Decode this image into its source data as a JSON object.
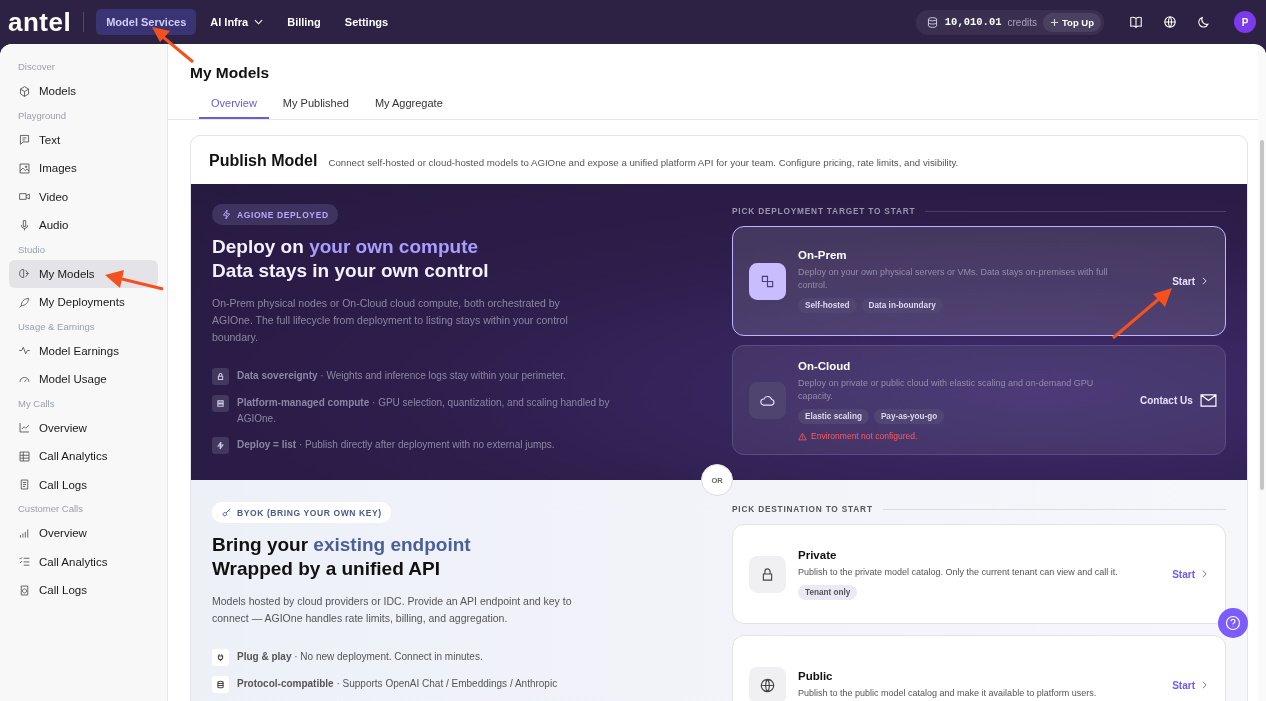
{
  "topbar": {
    "logo": "antel",
    "nav": [
      {
        "label": "Model Services",
        "selected": true,
        "dropdown": false
      },
      {
        "label": "AI Infra",
        "selected": false,
        "dropdown": true
      },
      {
        "label": "Billing",
        "selected": false,
        "dropdown": false
      },
      {
        "label": "Settings",
        "selected": false,
        "dropdown": false
      }
    ],
    "credits": {
      "amount": "10,010.01",
      "unit": "credits",
      "top_up": "Top Up"
    },
    "avatar": "P"
  },
  "sidebar": {
    "sections": [
      {
        "title": "Discover",
        "items": [
          {
            "label": "Models",
            "selected": false
          }
        ]
      },
      {
        "title": "Playground",
        "items": [
          {
            "label": "Text",
            "selected": false
          },
          {
            "label": "Images",
            "selected": false
          },
          {
            "label": "Video",
            "selected": false
          },
          {
            "label": "Audio",
            "selected": false
          }
        ]
      },
      {
        "title": "Studio",
        "items": [
          {
            "label": "My Models",
            "selected": true
          },
          {
            "label": "My Deployments",
            "selected": false
          }
        ]
      },
      {
        "title": "Usage & Earnings",
        "items": [
          {
            "label": "Model Earnings",
            "selected": false
          },
          {
            "label": "Model Usage",
            "selected": false
          }
        ]
      },
      {
        "title": "My Calls",
        "items": [
          {
            "label": "Overview",
            "selected": false
          },
          {
            "label": "Call Analytics",
            "selected": false
          },
          {
            "label": "Call Logs",
            "selected": false
          }
        ]
      },
      {
        "title": "Customer Calls",
        "items": [
          {
            "label": "Overview",
            "selected": false
          },
          {
            "label": "Call Analytics",
            "selected": false
          },
          {
            "label": "Call Logs",
            "selected": false
          }
        ]
      }
    ]
  },
  "page": {
    "title": "My Models",
    "tabs": [
      {
        "label": "Overview",
        "selected": true
      },
      {
        "label": "My Published",
        "selected": false
      },
      {
        "label": "My Aggregate",
        "selected": false
      }
    ]
  },
  "publish": {
    "title": "Publish Model",
    "subtitle": "Connect self-hosted or cloud-hosted models to AGIOne and expose a unified platform API for your team. Configure pricing, rate limits, and visibility.",
    "sections": [
      {
        "kind": "dark",
        "badge": "AGIONE DEPLOYED",
        "heading_lead": "Deploy on ",
        "heading_accent": "your own compute",
        "heading_line2": "Data stays in your own control",
        "description": "On-Prem physical nodes or On-Cloud cloud compute, both orchestrated by AGIOne. The full lifecycle from deployment to listing stays within your control boundary.",
        "features": [
          "**Data sovereignty** · Weights and inference logs stay within your perimeter.",
          "**Platform-managed compute** · GPU selection, quantization, and scaling handled by AGIOne.",
          "**Deploy = list** · Publish directly after deployment with no external jumps."
        ],
        "pick_label": "PICK DEPLOYMENT TARGET TO START",
        "options": [
          {
            "title": "On-Prem",
            "description": "Deploy on your own physical servers or VMs. Data stays on-premises with full control.",
            "tags": [
              "Self-hosted",
              "Data in-boundary"
            ],
            "action": "Start",
            "kind": "start",
            "selected": true
          },
          {
            "title": "On-Cloud",
            "description": "Deploy on private or public cloud with elastic scaling and on-demand GPU capacity.",
            "tags": [
              "Elastic scaling",
              "Pay-as-you-go"
            ],
            "action": "Contact Us",
            "kind": "contact",
            "warning": "Environment not configured.",
            "selected": false
          }
        ]
      },
      {
        "kind": "light",
        "badge": "BYOK (BRING YOUR OWN KEY)",
        "heading_lead": "Bring your ",
        "heading_accent": "existing endpoint",
        "heading_line2": "Wrapped by a unified API",
        "description": "Models hosted by cloud providers or IDC. Provide an API endpoint and key to connect — AGIOne handles rate limits, billing, and aggregation.",
        "features": [
          "**Plug & play** · No new deployment. Connect in minutes.",
          "**Protocol-compatible** · Supports OpenAI Chat / Embeddings / Anthropic"
        ],
        "pick_label": "PICK DESTINATION TO START",
        "options": [
          {
            "title": "Private",
            "description": "Publish to the private model catalog. Only the current tenant can view and call it.",
            "tags": [
              "Tenant only"
            ],
            "action": "Start",
            "kind": "start",
            "selected": false
          },
          {
            "title": "Public",
            "description": "Publish to the public model catalog and make it available to platform users.",
            "action": "Start",
            "kind": "start",
            "selected": false
          }
        ]
      }
    ],
    "divider": "OR"
  }
}
